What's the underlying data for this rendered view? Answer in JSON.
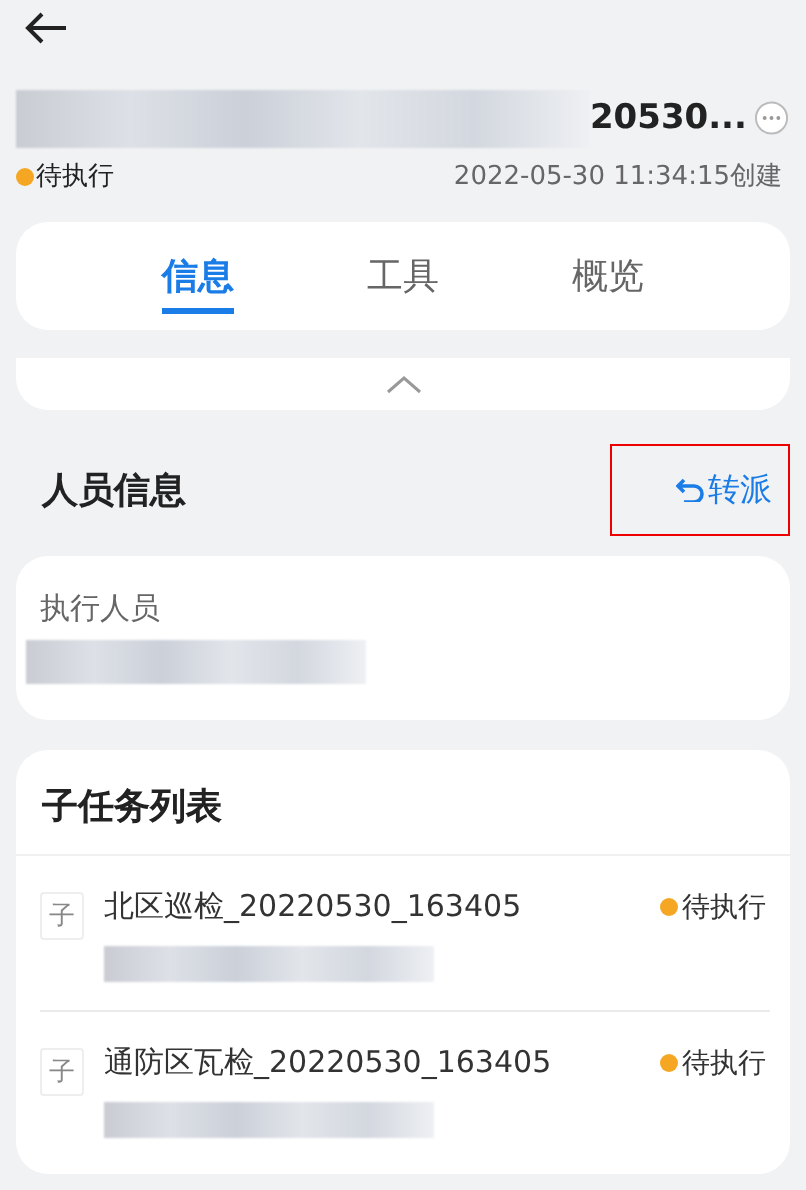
{
  "header": {
    "title_visible_end": "20530...",
    "status": {
      "label": "待执行",
      "color": "#f5a623"
    },
    "created": "2022-05-30 11:34:15创建"
  },
  "tabs": [
    {
      "label": "信息",
      "selected": true
    },
    {
      "label": "工具",
      "selected": false
    },
    {
      "label": "概览",
      "selected": false
    }
  ],
  "personnel": {
    "title": "人员信息",
    "action": {
      "label": "转派",
      "highlighted": true
    },
    "field_label": "执行人员"
  },
  "subtasks": {
    "title": "子任务列表",
    "items": [
      {
        "badge": "子",
        "name": "北区巡检_20220530_163405",
        "status": "待执行",
        "color": "#f5a623"
      },
      {
        "badge": "子",
        "name": "通防区瓦检_20220530_163405",
        "status": "待执行",
        "color": "#f5a623"
      }
    ]
  }
}
